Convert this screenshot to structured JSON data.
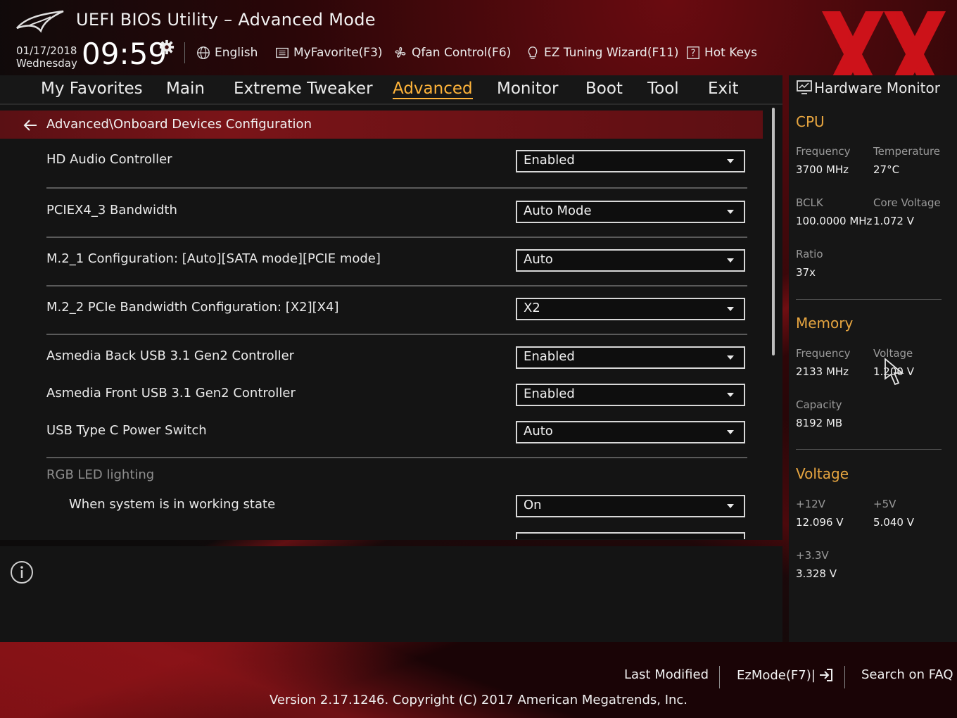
{
  "colors": {
    "accent": "#ffb43a",
    "section": "#e8a640",
    "header_bar": "#7a1418",
    "watermark": "#e0141c"
  },
  "header": {
    "title": "UEFI BIOS Utility – Advanced Mode",
    "date": "01/17/2018",
    "day": "Wednesday",
    "time": "09:59",
    "items": [
      {
        "label": "English",
        "icon": "globe-icon"
      },
      {
        "label": "MyFavorite(F3)",
        "icon": "favorite-list-icon"
      },
      {
        "label": "Qfan Control(F6)",
        "icon": "fan-icon"
      },
      {
        "label": "EZ Tuning Wizard(F11)",
        "icon": "lightbulb-icon"
      },
      {
        "label": "Hot Keys",
        "icon": "question-icon"
      }
    ]
  },
  "tabs": [
    "My Favorites",
    "Main",
    "Extreme Tweaker",
    "Advanced",
    "Monitor",
    "Boot",
    "Tool",
    "Exit"
  ],
  "active_tab": "Advanced",
  "breadcrumb": "Advanced\\Onboard Devices Configuration",
  "settings": [
    {
      "label": "HD Audio Controller",
      "value": "Enabled"
    },
    {
      "label": "PCIEX4_3 Bandwidth",
      "value": "Auto Mode"
    },
    {
      "label": "M.2_1 Configuration: [Auto][SATA mode][PCIE mode]",
      "value": "Auto"
    },
    {
      "label": "M.2_2 PCIe Bandwidth Configuration: [X2][X4]",
      "value": "X2"
    },
    {
      "label": "Asmedia Back USB 3.1 Gen2 Controller",
      "value": "Enabled"
    },
    {
      "label": "Asmedia Front USB 3.1 Gen2 Controller",
      "value": "Enabled"
    },
    {
      "label": "USB Type C Power Switch",
      "value": "Auto"
    }
  ],
  "rgb_section": "RGB LED lighting",
  "rgb_setting": {
    "label": "When system is in working state",
    "value": "On"
  },
  "hw": {
    "title": "Hardware Monitor",
    "cpu": {
      "title": "CPU",
      "freq_label": "Frequency",
      "freq": "3700 MHz",
      "temp_label": "Temperature",
      "temp": "27°C",
      "bclk_label": "BCLK",
      "bclk": "100.0000 MHz",
      "cvolt_label": "Core Voltage",
      "cvolt": "1.072 V",
      "ratio_label": "Ratio",
      "ratio": "37x"
    },
    "memory": {
      "title": "Memory",
      "freq_label": "Frequency",
      "freq": "2133 MHz",
      "volt_label": "Voltage",
      "volt": "1.200 V",
      "cap_label": "Capacity",
      "cap": "8192 MB"
    },
    "voltage": {
      "title": "Voltage",
      "v12_label": "+12V",
      "v12": "12.096 V",
      "v5_label": "+5V",
      "v5": "5.040 V",
      "v33_label": "+3.3V",
      "v33": "3.328 V"
    }
  },
  "footer": {
    "last_modified": "Last Modified",
    "ezmode": "EzMode(F7)|",
    "faq": "Search on FAQ",
    "version": "Version 2.17.1246. Copyright (C) 2017 American Megatrends, Inc."
  }
}
